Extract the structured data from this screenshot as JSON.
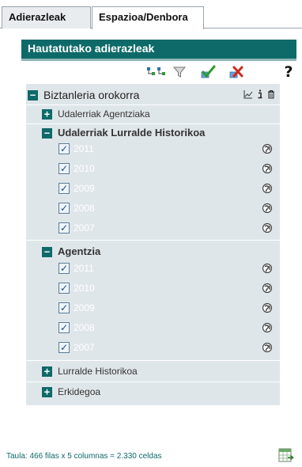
{
  "tabs": [
    {
      "label": "Adierazleak",
      "active": false
    },
    {
      "label": "Espazioa/Denbora",
      "active": true
    }
  ],
  "panel": {
    "title": "Hautatutako adierazleak"
  },
  "toolbar": {
    "icons": [
      "tree-expand-icon",
      "filter-icon",
      "check-all-icon",
      "clear-all-icon",
      "help-icon"
    ],
    "help_label": "?"
  },
  "tree": {
    "root": {
      "label": "Biztanleria orokorra",
      "expander": "−",
      "icons": [
        "line-chart-icon",
        "info-icon",
        "trash-icon"
      ]
    },
    "groups": [
      {
        "label": "Udalerriak Agentziaka",
        "expander": "+",
        "expanded": false,
        "bold": false
      },
      {
        "label": "Udalerriak Lurralde Historikoa",
        "expander": "−",
        "expanded": true,
        "bold": true,
        "items": [
          {
            "label": "2011",
            "checked": true
          },
          {
            "label": "2010",
            "checked": true
          },
          {
            "label": "2009",
            "checked": true
          },
          {
            "label": "2008",
            "checked": true
          },
          {
            "label": "2007",
            "checked": true
          }
        ]
      },
      {
        "label": "Agentzia",
        "expander": "−",
        "expanded": true,
        "bold": true,
        "items": [
          {
            "label": "2011",
            "checked": true
          },
          {
            "label": "2010",
            "checked": true
          },
          {
            "label": "2009",
            "checked": true
          },
          {
            "label": "2008",
            "checked": true
          },
          {
            "label": "2007",
            "checked": true
          }
        ]
      },
      {
        "label": "Lurralde Historikoa",
        "expander": "+",
        "expanded": false,
        "bold": false
      },
      {
        "label": "Erkidegoa",
        "expander": "+",
        "expanded": false,
        "bold": false
      }
    ],
    "checkmark": "✓"
  },
  "footer": {
    "summary": "Taula: 466 filas x 5 columnas = 2.330 celdas"
  },
  "colors": {
    "accent": "#0e6a68",
    "tree_background": "#dfe6ea"
  }
}
